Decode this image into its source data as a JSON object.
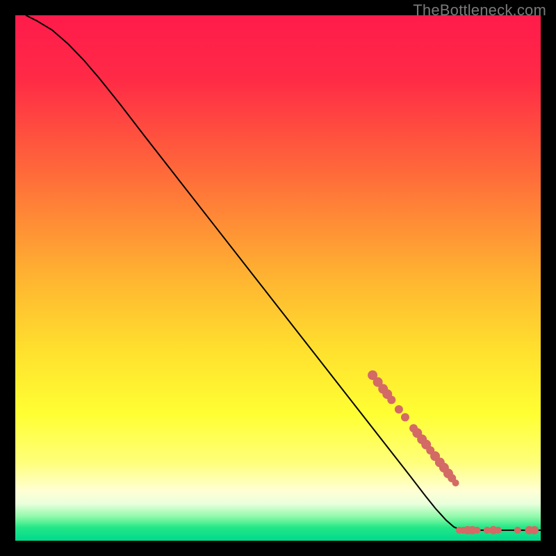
{
  "watermark": "TheBottleneck.com",
  "chart_data": {
    "type": "line",
    "title": "",
    "xlabel": "",
    "ylabel": "",
    "xlim": [
      0,
      100
    ],
    "ylim": [
      0,
      100
    ],
    "grid": false,
    "legend": false,
    "gradient_stops": [
      {
        "offset": 0.0,
        "color": "#ff1b4b"
      },
      {
        "offset": 0.12,
        "color": "#ff2a46"
      },
      {
        "offset": 0.3,
        "color": "#ff6a3a"
      },
      {
        "offset": 0.5,
        "color": "#ffb431"
      },
      {
        "offset": 0.64,
        "color": "#ffe12e"
      },
      {
        "offset": 0.76,
        "color": "#ffff33"
      },
      {
        "offset": 0.85,
        "color": "#ffff7a"
      },
      {
        "offset": 0.905,
        "color": "#ffffd4"
      },
      {
        "offset": 0.93,
        "color": "#e9ffdc"
      },
      {
        "offset": 0.955,
        "color": "#8df9a8"
      },
      {
        "offset": 0.975,
        "color": "#23e786"
      },
      {
        "offset": 1.0,
        "color": "#00d98d"
      }
    ],
    "series": [
      {
        "name": "curve",
        "type": "line",
        "color": "#000000",
        "points": [
          {
            "x": 2.0,
            "y": 100.0
          },
          {
            "x": 4.0,
            "y": 99.0
          },
          {
            "x": 7.0,
            "y": 97.2
          },
          {
            "x": 10.0,
            "y": 94.6
          },
          {
            "x": 13.0,
            "y": 91.5
          },
          {
            "x": 16.0,
            "y": 88.0
          },
          {
            "x": 20.0,
            "y": 83.0
          },
          {
            "x": 25.0,
            "y": 76.5
          },
          {
            "x": 30.0,
            "y": 70.1
          },
          {
            "x": 35.0,
            "y": 63.7
          },
          {
            "x": 40.0,
            "y": 57.3
          },
          {
            "x": 45.0,
            "y": 50.9
          },
          {
            "x": 50.0,
            "y": 44.5
          },
          {
            "x": 55.0,
            "y": 38.1
          },
          {
            "x": 60.0,
            "y": 31.7
          },
          {
            "x": 65.0,
            "y": 25.3
          },
          {
            "x": 70.0,
            "y": 18.9
          },
          {
            "x": 75.0,
            "y": 12.5
          },
          {
            "x": 78.0,
            "y": 8.6
          },
          {
            "x": 80.0,
            "y": 6.1
          },
          {
            "x": 82.0,
            "y": 3.9
          },
          {
            "x": 83.5,
            "y": 2.6
          },
          {
            "x": 85.0,
            "y": 2.0
          },
          {
            "x": 90.0,
            "y": 2.0
          },
          {
            "x": 95.0,
            "y": 2.0
          },
          {
            "x": 100.0,
            "y": 2.0
          }
        ]
      },
      {
        "name": "marks",
        "type": "scatter",
        "color": "#d36a65",
        "radius_default": 6,
        "points": [
          {
            "x": 68.0,
            "y": 31.5,
            "r": 7
          },
          {
            "x": 69.0,
            "y": 30.2,
            "r": 7
          },
          {
            "x": 70.0,
            "y": 28.9,
            "r": 7
          },
          {
            "x": 70.8,
            "y": 27.9,
            "r": 7
          },
          {
            "x": 71.6,
            "y": 26.8,
            "r": 6
          },
          {
            "x": 73.0,
            "y": 25.0,
            "r": 6
          },
          {
            "x": 74.2,
            "y": 23.5,
            "r": 6
          },
          {
            "x": 75.8,
            "y": 21.4,
            "r": 6
          },
          {
            "x": 76.5,
            "y": 20.5,
            "r": 7
          },
          {
            "x": 77.4,
            "y": 19.3,
            "r": 7
          },
          {
            "x": 78.2,
            "y": 18.3,
            "r": 7
          },
          {
            "x": 79.0,
            "y": 17.2,
            "r": 6
          },
          {
            "x": 79.9,
            "y": 16.1,
            "r": 7
          },
          {
            "x": 80.8,
            "y": 14.9,
            "r": 7
          },
          {
            "x": 81.6,
            "y": 13.9,
            "r": 7
          },
          {
            "x": 82.4,
            "y": 12.8,
            "r": 7
          },
          {
            "x": 83.1,
            "y": 11.9,
            "r": 6
          },
          {
            "x": 83.8,
            "y": 11.0,
            "r": 5
          },
          {
            "x": 84.5,
            "y": 2.0,
            "r": 5
          },
          {
            "x": 85.3,
            "y": 2.0,
            "r": 5
          },
          {
            "x": 86.1,
            "y": 2.0,
            "r": 6
          },
          {
            "x": 87.0,
            "y": 2.0,
            "r": 6
          },
          {
            "x": 87.9,
            "y": 2.0,
            "r": 5
          },
          {
            "x": 89.8,
            "y": 2.0,
            "r": 5
          },
          {
            "x": 91.0,
            "y": 2.0,
            "r": 6
          },
          {
            "x": 91.9,
            "y": 2.0,
            "r": 5
          },
          {
            "x": 95.6,
            "y": 2.0,
            "r": 5
          },
          {
            "x": 97.8,
            "y": 2.0,
            "r": 6
          },
          {
            "x": 98.8,
            "y": 2.0,
            "r": 6
          }
        ]
      }
    ]
  }
}
